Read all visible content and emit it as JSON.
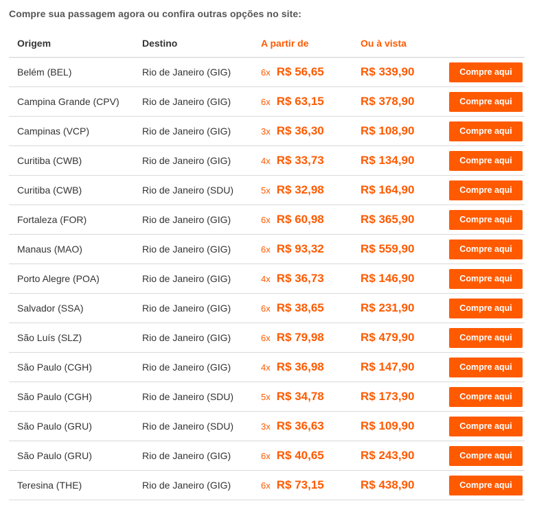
{
  "intro_text": "Compre sua passagem agora ou confira outras opções no site:",
  "accent_color": "#ff5a00",
  "table": {
    "headers": {
      "origin": "Origem",
      "destination": "Destino",
      "from_price": "A partir de",
      "cash_price": "Ou à vista"
    },
    "buy_label": "Compre aqui",
    "rows": [
      {
        "origin": "Belém (BEL)",
        "destination": "Rio de Janeiro (GIG)",
        "installments": "6x",
        "installment_price": "R$ 56,65",
        "cash_price": "R$ 339,90"
      },
      {
        "origin": "Campina Grande (CPV)",
        "destination": "Rio de Janeiro (GIG)",
        "installments": "6x",
        "installment_price": "R$ 63,15",
        "cash_price": "R$ 378,90"
      },
      {
        "origin": "Campinas (VCP)",
        "destination": "Rio de Janeiro (GIG)",
        "installments": "3x",
        "installment_price": "R$ 36,30",
        "cash_price": "R$ 108,90"
      },
      {
        "origin": "Curitiba (CWB)",
        "destination": "Rio de Janeiro (GIG)",
        "installments": "4x",
        "installment_price": "R$ 33,73",
        "cash_price": "R$ 134,90"
      },
      {
        "origin": "Curitiba (CWB)",
        "destination": "Rio de Janeiro (SDU)",
        "installments": "5x",
        "installment_price": "R$ 32,98",
        "cash_price": "R$ 164,90"
      },
      {
        "origin": "Fortaleza (FOR)",
        "destination": "Rio de Janeiro (GIG)",
        "installments": "6x",
        "installment_price": "R$ 60,98",
        "cash_price": "R$ 365,90"
      },
      {
        "origin": "Manaus (MAO)",
        "destination": "Rio de Janeiro (GIG)",
        "installments": "6x",
        "installment_price": "R$ 93,32",
        "cash_price": "R$ 559,90"
      },
      {
        "origin": "Porto Alegre (POA)",
        "destination": "Rio de Janeiro (GIG)",
        "installments": "4x",
        "installment_price": "R$ 36,73",
        "cash_price": "R$ 146,90"
      },
      {
        "origin": "Salvador (SSA)",
        "destination": "Rio de Janeiro (GIG)",
        "installments": "6x",
        "installment_price": "R$ 38,65",
        "cash_price": "R$ 231,90"
      },
      {
        "origin": "São Luís (SLZ)",
        "destination": "Rio de Janeiro (GIG)",
        "installments": "6x",
        "installment_price": "R$ 79,98",
        "cash_price": "R$ 479,90"
      },
      {
        "origin": "São Paulo (CGH)",
        "destination": "Rio de Janeiro (GIG)",
        "installments": "4x",
        "installment_price": "R$ 36,98",
        "cash_price": "R$ 147,90"
      },
      {
        "origin": "São Paulo (CGH)",
        "destination": "Rio de Janeiro (SDU)",
        "installments": "5x",
        "installment_price": "R$ 34,78",
        "cash_price": "R$ 173,90"
      },
      {
        "origin": "São Paulo (GRU)",
        "destination": "Rio de Janeiro (SDU)",
        "installments": "3x",
        "installment_price": "R$ 36,63",
        "cash_price": "R$ 109,90"
      },
      {
        "origin": "São Paulo (GRU)",
        "destination": "Rio de Janeiro (GIG)",
        "installments": "6x",
        "installment_price": "R$ 40,65",
        "cash_price": "R$ 243,90"
      },
      {
        "origin": "Teresina (THE)",
        "destination": "Rio de Janeiro (GIG)",
        "installments": "6x",
        "installment_price": "R$ 73,15",
        "cash_price": "R$ 438,90"
      }
    ]
  }
}
